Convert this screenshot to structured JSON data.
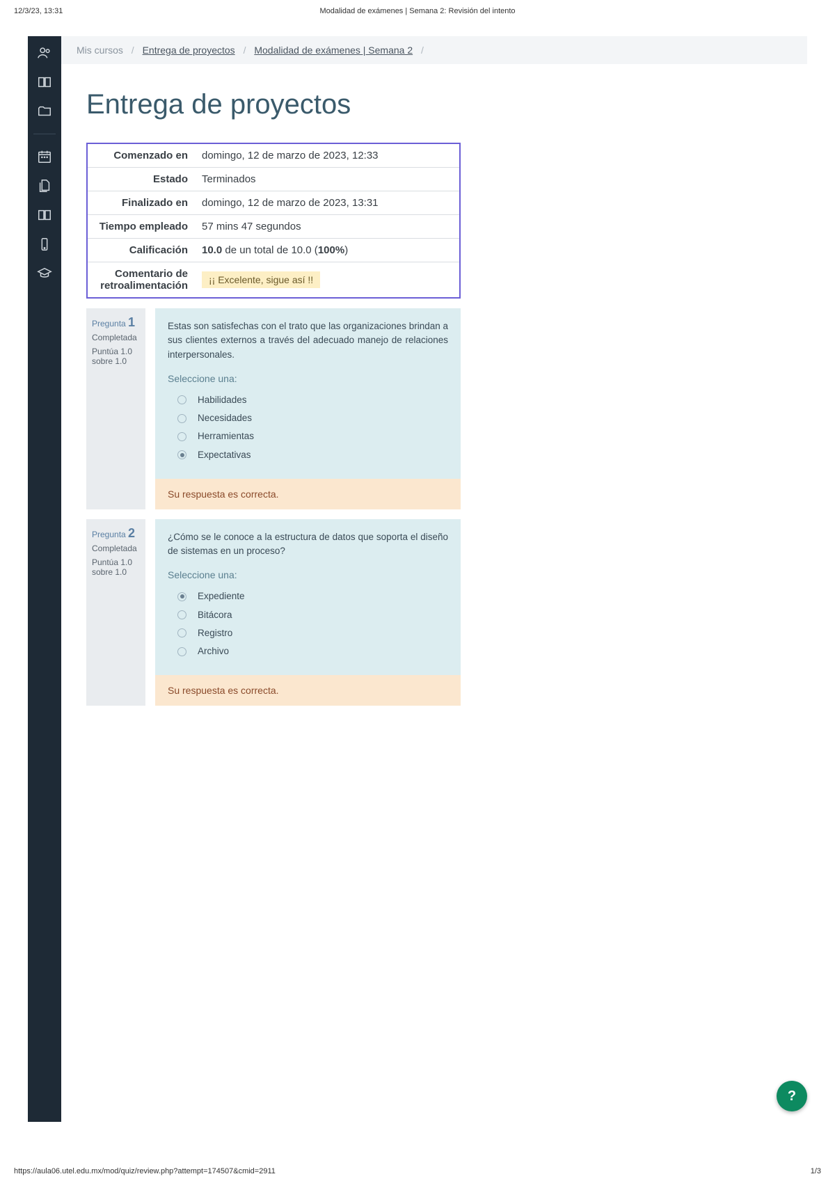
{
  "print": {
    "timestamp": "12/3/23, 13:31",
    "title": "Modalidad de exámenes | Semana 2: Revisión del intento",
    "url": "https://aula06.utel.edu.mx/mod/quiz/review.php?attempt=174507&cmid=2911",
    "page": "1/3"
  },
  "breadcrumb": {
    "mis_cursos": "Mis cursos",
    "course": "Entrega de proyectos",
    "activity": "Modalidad de exámenes | Semana 2"
  },
  "title": "Entrega de proyectos",
  "summary": {
    "started_label": "Comenzado en",
    "started_value": "domingo, 12 de marzo de 2023, 12:33",
    "state_label": "Estado",
    "state_value": "Terminados",
    "finished_label": "Finalizado en",
    "finished_value": "domingo, 12 de marzo de 2023, 13:31",
    "time_label": "Tiempo empleado",
    "time_value": "57 mins 47 segundos",
    "grade_label": "Calificación",
    "grade_value_strong": "10.0",
    "grade_value_mid": " de un total de 10.0 (",
    "grade_value_pct": "100%",
    "grade_value_end": ")",
    "feedback_label": "Comentario de retroalimentación",
    "feedback_value": "¡¡ Excelente, sigue así !!"
  },
  "questions": [
    {
      "label": "Pregunta",
      "number": "1",
      "state": "Completada",
      "grade": "Puntúa 1.0 sobre 1.0",
      "text": "Estas son satisfechas con el trato que las organizaciones brindan a sus clientes externos a través del adecuado manejo de relaciones interpersonales.",
      "select_label": "Seleccione una:",
      "options": [
        {
          "label": "Habilidades",
          "selected": false
        },
        {
          "label": "Necesidades",
          "selected": false
        },
        {
          "label": "Herramientas",
          "selected": false
        },
        {
          "label": "Expectativas",
          "selected": true
        }
      ],
      "feedback": "Su respuesta es correcta."
    },
    {
      "label": "Pregunta",
      "number": "2",
      "state": "Completada",
      "grade": "Puntúa 1.0 sobre 1.0",
      "text": "¿Cómo se le conoce a la estructura de datos que soporta el diseño de sistemas en un proceso?",
      "select_label": "Seleccione una:",
      "options": [
        {
          "label": "Expediente",
          "selected": true
        },
        {
          "label": "Bitácora",
          "selected": false
        },
        {
          "label": "Registro",
          "selected": false
        },
        {
          "label": "Archivo",
          "selected": false
        }
      ],
      "feedback": "Su respuesta es correcta."
    }
  ],
  "help": "?"
}
